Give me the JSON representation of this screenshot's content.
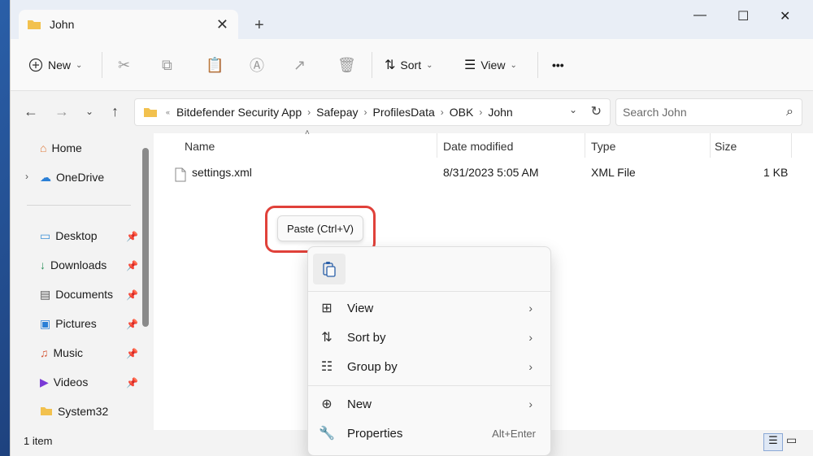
{
  "window": {
    "tab_title": "John",
    "new_tab_symbol": "+",
    "controls": {
      "minimize": "—",
      "maximize": "☐",
      "close": "✕"
    }
  },
  "toolbar": {
    "new_label": "New",
    "sort_label": "Sort",
    "view_label": "View",
    "more_label": "•••"
  },
  "address": {
    "overflow": "«",
    "crumbs": [
      "Bitdefender Security App",
      "Safepay",
      "ProfilesData",
      "OBK",
      "John"
    ]
  },
  "search": {
    "placeholder": "Search John"
  },
  "sidebar": {
    "items": [
      {
        "label": "Home",
        "icon": "home-icon",
        "pinned": false
      },
      {
        "label": "OneDrive",
        "icon": "cloud-icon",
        "pinned": false
      },
      {
        "label": "Desktop",
        "icon": "desktop-icon",
        "pinned": true
      },
      {
        "label": "Downloads",
        "icon": "download-icon",
        "pinned": true
      },
      {
        "label": "Documents",
        "icon": "document-icon",
        "pinned": true
      },
      {
        "label": "Pictures",
        "icon": "picture-icon",
        "pinned": true
      },
      {
        "label": "Music",
        "icon": "music-icon",
        "pinned": true
      },
      {
        "label": "Videos",
        "icon": "video-icon",
        "pinned": true
      },
      {
        "label": "System32",
        "icon": "folder-icon",
        "pinned": false
      }
    ]
  },
  "list": {
    "columns": {
      "name": "Name",
      "date": "Date modified",
      "type": "Type",
      "size": "Size"
    },
    "rows": [
      {
        "name": "settings.xml",
        "date": "8/31/2023 5:05 AM",
        "type": "XML File",
        "size": "1 KB"
      }
    ]
  },
  "status": {
    "count": "1 item"
  },
  "tooltip": {
    "text": "Paste (Ctrl+V)"
  },
  "context_menu": {
    "view": "View",
    "sort_by": "Sort by",
    "group_by": "Group by",
    "new": "New",
    "properties": "Properties",
    "properties_shortcut": "Alt+Enter"
  },
  "colors": {
    "accent": "#2a5fa8",
    "highlight_ring": "#e0413a",
    "folder": "#f2c14e"
  }
}
